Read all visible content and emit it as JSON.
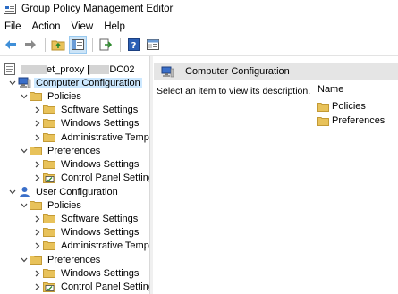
{
  "window": {
    "title": "Group Policy Management Editor",
    "app_icon": "gpo-editor-icon"
  },
  "menu": [
    "File",
    "Action",
    "View",
    "Help"
  ],
  "toolbar": [
    "back-arrow-icon",
    "forward-arrow-icon",
    "up-folder-icon",
    "show-hide-tree-icon",
    "export-list-icon",
    "help-icon",
    "properties-icon"
  ],
  "tree": {
    "root": {
      "label_visible_parts": [
        "et_proxy [",
        "DC02"
      ],
      "icon": "gpo-icon"
    },
    "items": [
      {
        "id": "computer-configuration",
        "label": "Computer Configuration",
        "icon": "computer-icon",
        "expanded": true,
        "selected": true
      },
      {
        "id": "cc-policies",
        "label": "Policies",
        "icon": "folder-icon",
        "expanded": true
      },
      {
        "id": "cc-software-settings",
        "label": "Software Settings",
        "icon": "folder-icon"
      },
      {
        "id": "cc-windows-settings",
        "label": "Windows Settings",
        "icon": "folder-icon"
      },
      {
        "id": "cc-admin-templates",
        "label": "Administrative Templ",
        "icon": "folder-icon"
      },
      {
        "id": "cc-preferences",
        "label": "Preferences",
        "icon": "folder-icon",
        "expanded": true
      },
      {
        "id": "cc-pref-windows-settings",
        "label": "Windows Settings",
        "icon": "folder-icon"
      },
      {
        "id": "cc-pref-control-panel",
        "label": "Control Panel Setting",
        "icon": "control-panel-icon"
      },
      {
        "id": "user-configuration",
        "label": "User Configuration",
        "icon": "user-icon",
        "expanded": true
      },
      {
        "id": "uc-policies",
        "label": "Policies",
        "icon": "folder-icon",
        "expanded": true
      },
      {
        "id": "uc-software-settings",
        "label": "Software Settings",
        "icon": "folder-icon"
      },
      {
        "id": "uc-windows-settings",
        "label": "Windows Settings",
        "icon": "folder-icon"
      },
      {
        "id": "uc-admin-templates",
        "label": "Administrative Templ",
        "icon": "folder-icon"
      },
      {
        "id": "uc-preferences",
        "label": "Preferences",
        "icon": "folder-icon",
        "expanded": true
      },
      {
        "id": "uc-pref-windows-settings",
        "label": "Windows Settings",
        "icon": "folder-icon"
      },
      {
        "id": "uc-pref-control-panel",
        "label": "Control Panel Setting",
        "icon": "control-panel-icon"
      }
    ]
  },
  "details": {
    "header": "Computer Configuration",
    "description": "Select an item to view its description.",
    "column_name": "Name",
    "items": [
      "Policies",
      "Preferences"
    ]
  },
  "colors": {
    "selection": "#cce8ff",
    "header_bg": "#e5e5e5",
    "folder": "#e8c25a"
  }
}
